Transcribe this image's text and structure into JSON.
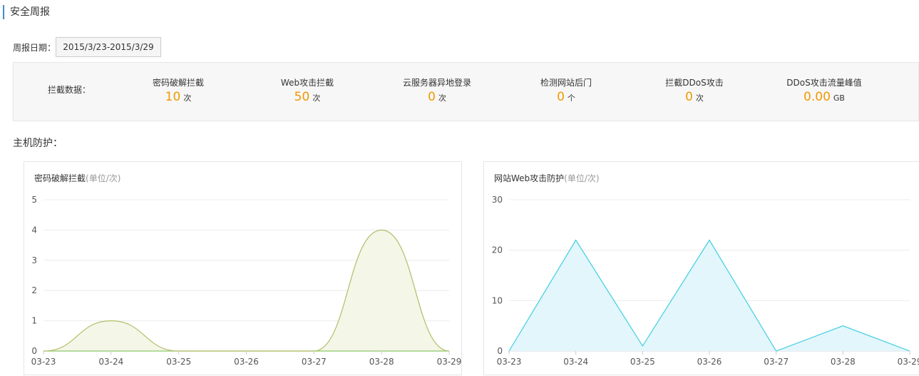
{
  "header": {
    "title": "安全周报"
  },
  "report": {
    "date_label": "周报日期：",
    "date_value": "2015/3/23-2015/3/29"
  },
  "stats": {
    "label": "拦截数据：",
    "items": [
      {
        "name": "密码破解拦截",
        "value": "10",
        "unit": "次"
      },
      {
        "name": "Web攻击拦截",
        "value": "50",
        "unit": "次"
      },
      {
        "name": "云服务器异地登录",
        "value": "0",
        "unit": "次"
      },
      {
        "name": "检测网站后门",
        "value": "0",
        "unit": "个"
      },
      {
        "name": "拦截DDoS攻击",
        "value": "0",
        "unit": "次"
      },
      {
        "name": "DDoS攻击流量峰值",
        "value": "0.00",
        "unit": "GB"
      }
    ]
  },
  "section": {
    "title": "主机防护："
  },
  "chart_data": [
    {
      "type": "area",
      "title": "密码破解拦截",
      "unit_note": "(单位/次)",
      "categories": [
        "03-23",
        "03-24",
        "03-25",
        "03-26",
        "03-27",
        "03-28",
        "03-29"
      ],
      "values": [
        0,
        1,
        0,
        0,
        0,
        4,
        0
      ],
      "ylim": [
        0,
        5
      ],
      "yticks": [
        0,
        1,
        2,
        3,
        4,
        5
      ],
      "smooth": true,
      "grid": true,
      "line_color": "#b5bd68",
      "fill_color": "#f4f6e8"
    },
    {
      "type": "area",
      "title": "网站Web攻击防护",
      "unit_note": "(单位/次)",
      "categories": [
        "03-23",
        "03-24",
        "03-25",
        "03-26",
        "03-27",
        "03-28",
        "03-29"
      ],
      "values": [
        0,
        22,
        1,
        22,
        0,
        5,
        0
      ],
      "ylim": [
        0,
        30
      ],
      "yticks": [
        0,
        10,
        20,
        30
      ],
      "smooth": false,
      "grid": true,
      "line_color": "#3fcfe0",
      "fill_color": "#e3f6fb"
    }
  ]
}
